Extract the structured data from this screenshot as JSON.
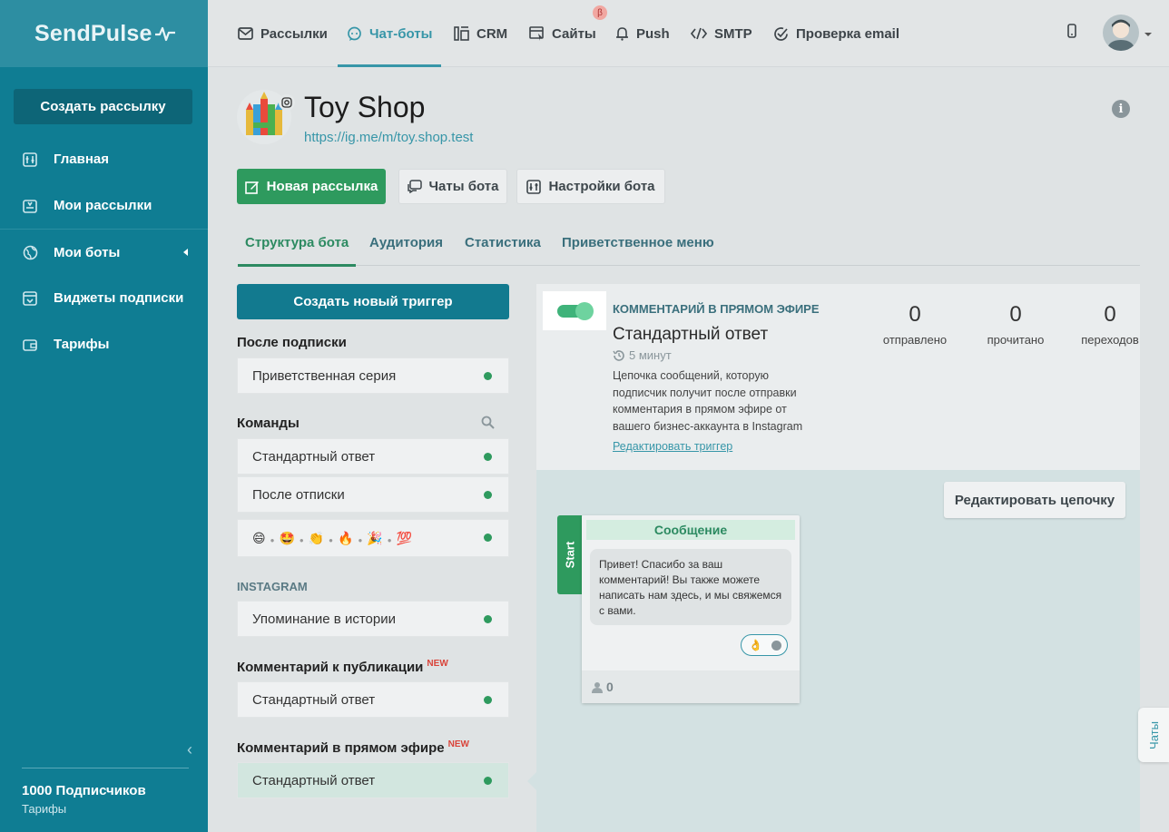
{
  "sidebar": {
    "logo": "SendPulse",
    "create_button": "Создать рассылку",
    "items": [
      {
        "label": "Главная",
        "icon": "home-icon"
      },
      {
        "label": "Мои рассылки",
        "icon": "mailings-icon"
      },
      {
        "label": "Мои боты",
        "icon": "globe-icon"
      },
      {
        "label": "Виджеты подписки",
        "icon": "widget-icon"
      },
      {
        "label": "Тарифы",
        "icon": "wallet-icon"
      }
    ],
    "subscribers": "1000 Подписчиков",
    "plan": "Тарифы"
  },
  "topnav": {
    "items": [
      {
        "label": "Рассылки",
        "icon": "mail-icon"
      },
      {
        "label": "Чат-боты",
        "icon": "chat-icon"
      },
      {
        "label": "CRM",
        "icon": "crm-icon"
      },
      {
        "label": "Сайты",
        "icon": "site-icon"
      },
      {
        "label": "Push",
        "icon": "bell-icon"
      },
      {
        "label": "SMTP",
        "icon": "code-icon"
      },
      {
        "label": "Проверка email",
        "icon": "check-icon"
      }
    ],
    "beta": "β",
    "active": "Чат-боты"
  },
  "bot": {
    "name": "Toy Shop",
    "link": "https://ig.me/m/toy.shop.test"
  },
  "actions": {
    "new_mailing": "Новая рассылка",
    "bot_chats": "Чаты бота",
    "bot_settings": "Настройки бота"
  },
  "tabs": [
    "Структура бота",
    "Аудитория",
    "Статистика",
    "Приветственное меню"
  ],
  "left": {
    "new_trigger": "Создать новый триггер",
    "after_subscribe": "После подписки",
    "welcome_series": "Приветственная серия",
    "commands": "Команды",
    "cmd_standard": "Стандартный ответ",
    "cmd_unsub": "После отписки",
    "emojis": [
      "😄",
      "🤩",
      "👏",
      "🔥",
      "🎉",
      "💯"
    ],
    "instagram": "INSTAGRAM",
    "story_mention": "Упоминание в истории",
    "post_comment": "Комментарий к публикации",
    "new_badge": "NEW",
    "post_standard": "Стандартный ответ",
    "live_comment": "Комментарий в прямом эфире",
    "live_standard": "Стандартный ответ"
  },
  "trigger": {
    "kind": "КОММЕНТАРИЙ В ПРЯМОМ ЭФИРЕ",
    "name": "Стандартный ответ",
    "delay": "5 минут",
    "description": "Цепочка сообщений, которую подписчик получит после отправки комментария в прямом эфире от вашего бизнес-аккаунта в Instagram",
    "edit_link": "Редактировать триггер",
    "enabled": true,
    "stats": [
      {
        "value": "0",
        "label": "отправлено"
      },
      {
        "value": "0",
        "label": "прочитано"
      },
      {
        "value": "0",
        "label": "переходов"
      }
    ]
  },
  "flow": {
    "edit_chain": "Редактировать цепочку",
    "start": "Start",
    "message_title": "Сообщение",
    "message_text": "Привет! Спасибо за ваш комментарий! Вы также можете написать нам здесь, и мы свяжемся с вами.",
    "reaction": "👌",
    "count": "0"
  },
  "chats_tab": "Чаты",
  "colors": {
    "sidebar": "#0f7d93",
    "accent": "#3796a8",
    "green": "#2e9a5e"
  }
}
